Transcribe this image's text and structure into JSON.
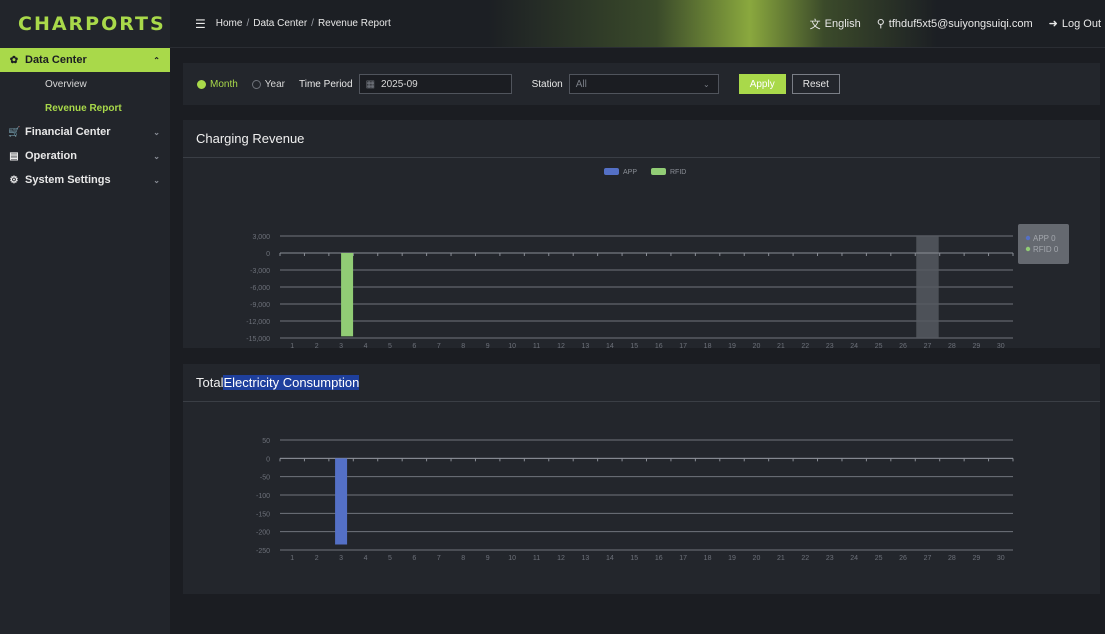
{
  "app": {
    "logo": "CHARPORTS"
  },
  "sidebar": {
    "groups": [
      {
        "label": "Data Center",
        "icon": "dashboard-icon",
        "active": true,
        "items": [
          {
            "label": "Overview",
            "active": false
          },
          {
            "label": "Revenue Report",
            "active": true
          }
        ]
      },
      {
        "label": "Financial Center",
        "icon": "cart-icon",
        "active": false,
        "items": []
      },
      {
        "label": "Operation",
        "icon": "monitor-icon",
        "active": false,
        "items": []
      },
      {
        "label": "System Settings",
        "icon": "gear-icon",
        "active": false,
        "items": []
      }
    ]
  },
  "header": {
    "breadcrumb": [
      "Home",
      "Data Center",
      "Revenue Report"
    ],
    "language": "English",
    "user_email": "tfhduf5xt5@suiyongsuiqi.com",
    "logout": "Log Out"
  },
  "filters": {
    "period_options": [
      {
        "label": "Month",
        "checked": true
      },
      {
        "label": "Year",
        "checked": false
      }
    ],
    "time_period_label": "Time Period",
    "time_period_value": "2025-09",
    "station_label": "Station",
    "station_value": "All",
    "apply": "Apply",
    "reset": "Reset"
  },
  "colors": {
    "accent": "#a9d94a",
    "app": "#5470c6",
    "rfid": "#91cc75"
  },
  "panels": {
    "revenue_title": "Charging Revenue",
    "consumption_title_plain": "Total ",
    "consumption_title_highlight": "Electricity Consumption"
  },
  "chart_data": [
    {
      "type": "bar",
      "title": "Charging Revenue",
      "legend": [
        "APP",
        "RFID"
      ],
      "legend_position": "top-center",
      "categories": [
        "1",
        "2",
        "3",
        "4",
        "5",
        "6",
        "7",
        "8",
        "9",
        "10",
        "11",
        "12",
        "13",
        "14",
        "15",
        "16",
        "17",
        "18",
        "19",
        "20",
        "21",
        "22",
        "23",
        "24",
        "25",
        "26",
        "27",
        "28",
        "29",
        "30"
      ],
      "y_ticks": [
        "3,000",
        "0",
        "-3,000",
        "-6,000",
        "-9,000",
        "-12,000",
        "-15,000"
      ],
      "ylim": [
        -15000,
        3000
      ],
      "series": [
        {
          "name": "APP",
          "values": [
            0,
            0,
            0,
            0,
            0,
            0,
            0,
            0,
            0,
            0,
            0,
            0,
            0,
            0,
            0,
            0,
            0,
            0,
            0,
            0,
            0,
            0,
            0,
            0,
            0,
            0,
            0,
            0,
            0,
            0
          ]
        },
        {
          "name": "RFID",
          "values": [
            0,
            0,
            -14700,
            0,
            0,
            0,
            0,
            0,
            0,
            0,
            0,
            0,
            0,
            0,
            0,
            0,
            0,
            0,
            0,
            0,
            0,
            0,
            0,
            0,
            0,
            0,
            0,
            0,
            0,
            0
          ]
        }
      ],
      "hover_category": "27",
      "tooltip": [
        "APP 0",
        "RFID 0"
      ],
      "grid": true
    },
    {
      "type": "bar",
      "title": "Total Electricity Consumption",
      "categories": [
        "1",
        "2",
        "3",
        "4",
        "5",
        "6",
        "7",
        "8",
        "9",
        "10",
        "11",
        "12",
        "13",
        "14",
        "15",
        "16",
        "17",
        "18",
        "19",
        "20",
        "21",
        "22",
        "23",
        "24",
        "25",
        "26",
        "27",
        "28",
        "29",
        "30"
      ],
      "y_ticks": [
        "50",
        "0",
        "-50",
        "-100",
        "-150",
        "-200",
        "-250"
      ],
      "ylim": [
        -250,
        50
      ],
      "series": [
        {
          "values": [
            0,
            0,
            -235,
            0,
            0,
            0,
            0,
            0,
            0,
            0,
            0,
            0,
            0,
            0,
            0,
            0,
            0,
            0,
            0,
            0,
            0,
            0,
            0,
            0,
            0,
            0,
            0,
            0,
            0,
            0
          ]
        }
      ],
      "grid": true
    }
  ]
}
